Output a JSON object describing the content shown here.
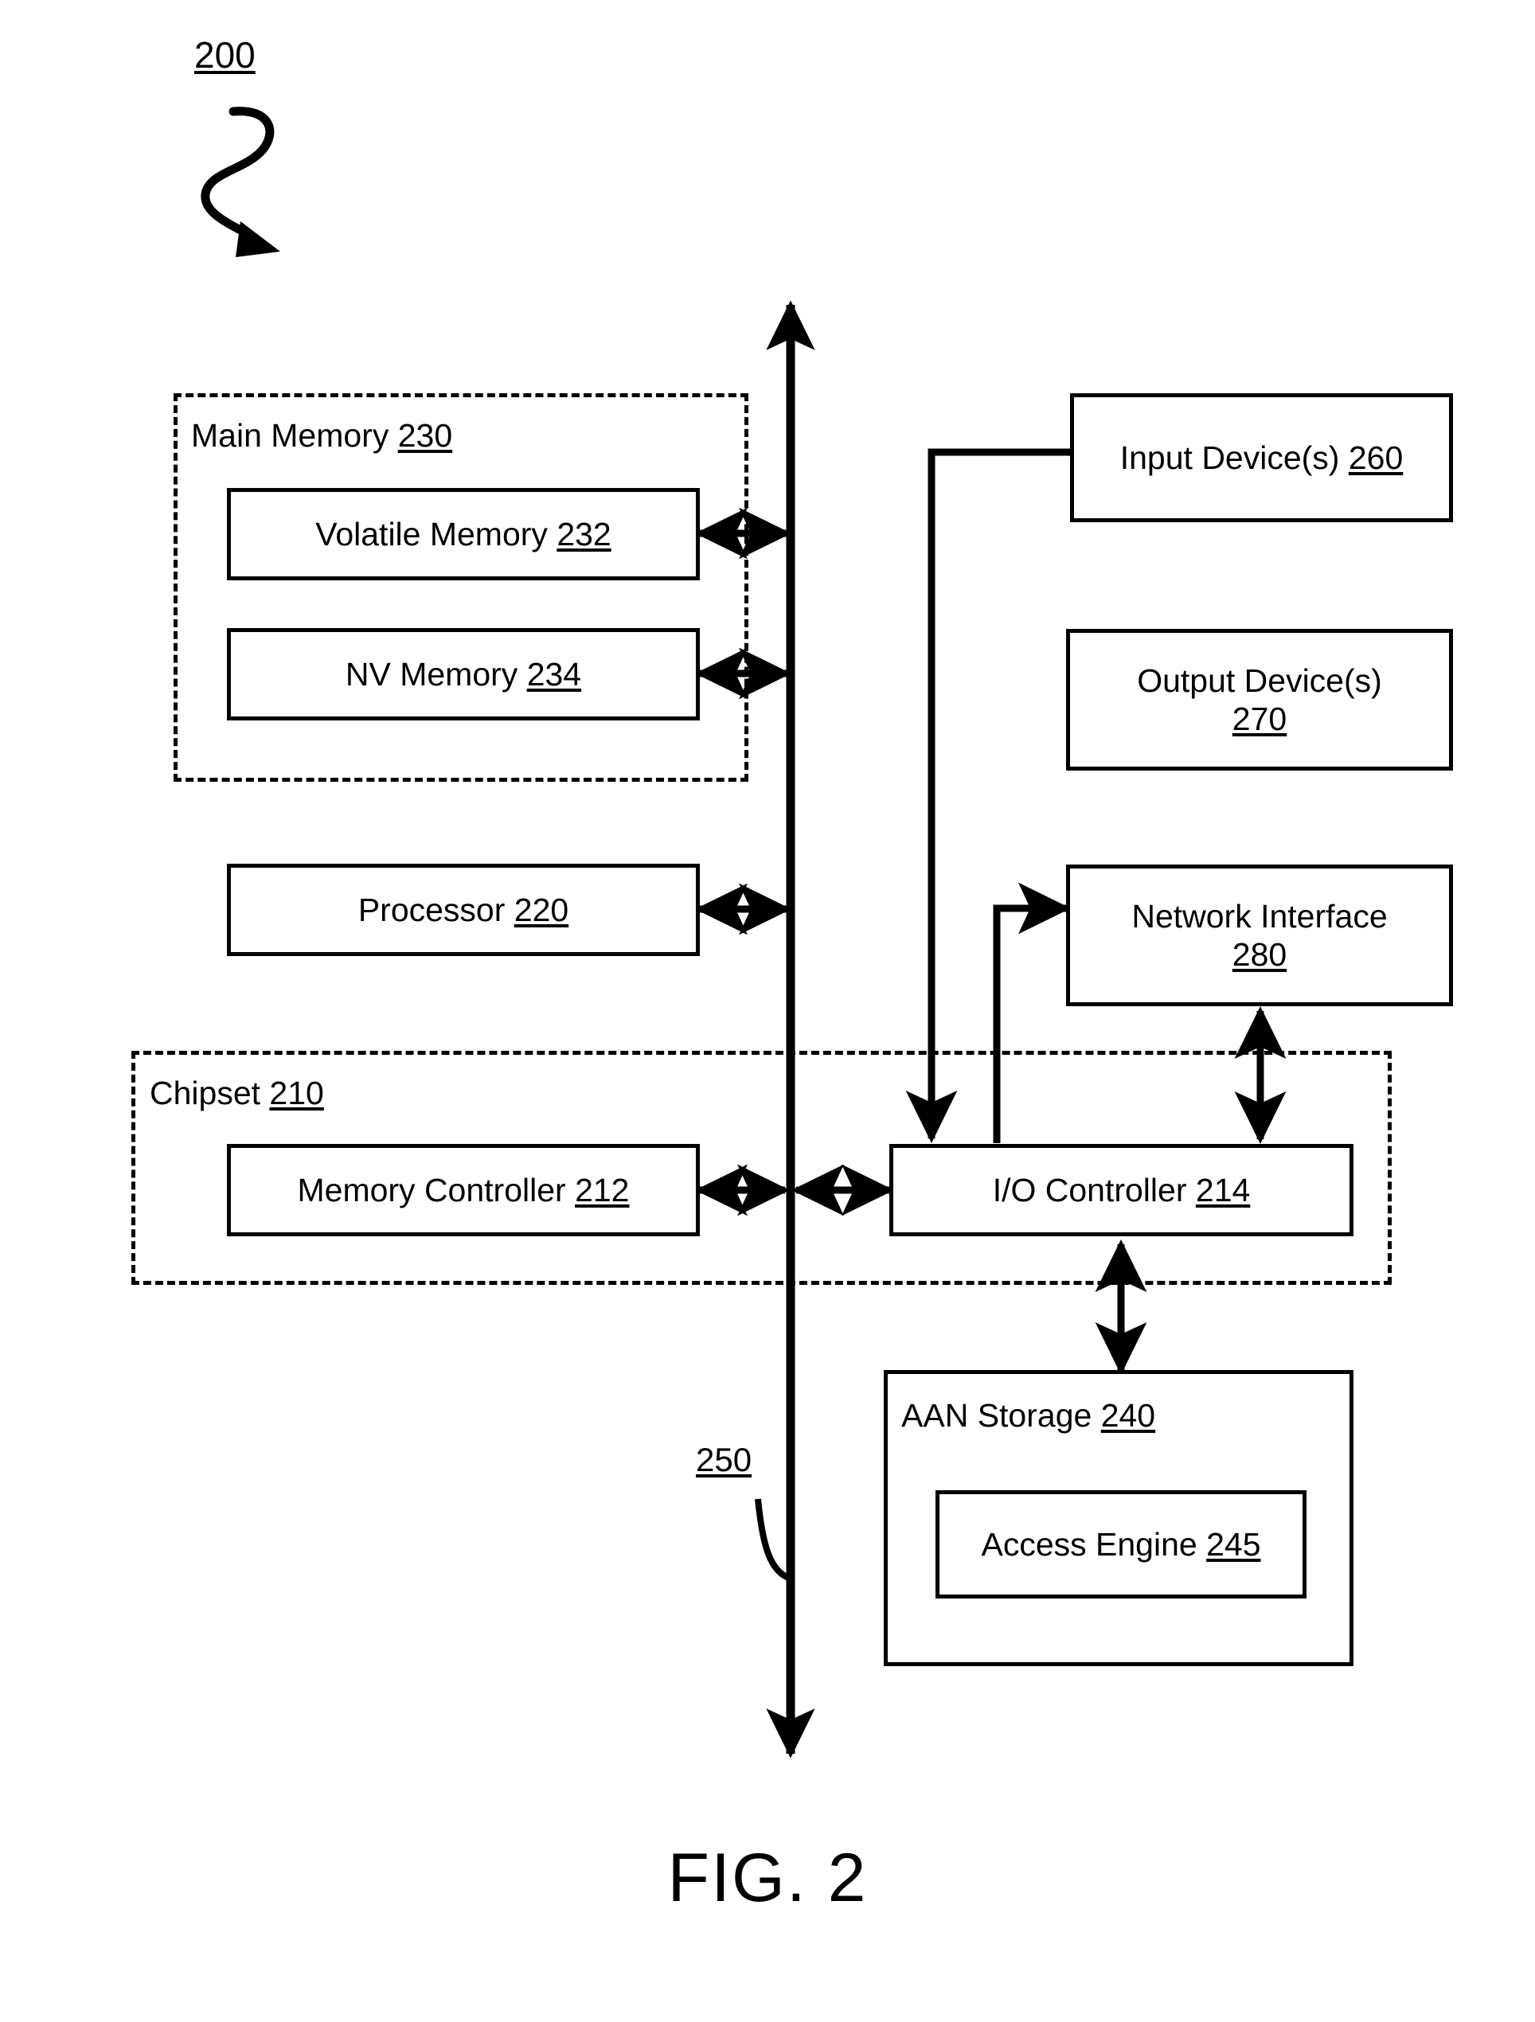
{
  "figure": {
    "caption": "FIG. 2",
    "system_tag": "200",
    "bus_tag": "250"
  },
  "groups": [
    {
      "key": "main_memory",
      "title": "Main Memory",
      "ref": "230"
    },
    {
      "key": "chipset",
      "title": "Chipset",
      "ref": "210"
    }
  ],
  "blocks": {
    "volatile_memory": {
      "label": "Volatile Memory 232"
    },
    "nv_memory": {
      "label": "NV Memory 234"
    },
    "processor": {
      "label": "Processor 220"
    },
    "memory_controller": {
      "label": "Memory Controller 212"
    },
    "io_controller": {
      "label": "I/O Controller 214"
    },
    "input_devices": {
      "label": "Input Device(s) 260"
    },
    "output_devices": {
      "label": "Output Device(s)\n270"
    },
    "network_interface": {
      "label": "Network Interface\n280"
    },
    "aan_storage": {
      "label": "AAN Storage 240"
    },
    "access_engine": {
      "label": "Access Engine 245"
    }
  },
  "connections": [
    {
      "name": "bus-250",
      "style": "double-arrow-vertical"
    },
    {
      "name": "volatile-memory-to-bus",
      "style": "double-arrow-horizontal"
    },
    {
      "name": "nv-memory-to-bus",
      "style": "double-arrow-horizontal"
    },
    {
      "name": "processor-to-bus",
      "style": "double-arrow-horizontal"
    },
    {
      "name": "memory-controller-to-bus",
      "style": "double-arrow-horizontal"
    },
    {
      "name": "bus-to-io-controller",
      "style": "double-arrow-horizontal"
    },
    {
      "name": "input-devices-to-io-controller",
      "style": "elbow-arrow-down"
    },
    {
      "name": "io-controller-to-output-devices",
      "style": "elbow-arrow-right"
    },
    {
      "name": "network-interface-to-io-controller",
      "style": "double-arrow-vertical"
    },
    {
      "name": "io-controller-to-aan-storage",
      "style": "double-arrow-vertical"
    }
  ],
  "colors": {
    "ink": "#000000",
    "paper": "#ffffff"
  }
}
